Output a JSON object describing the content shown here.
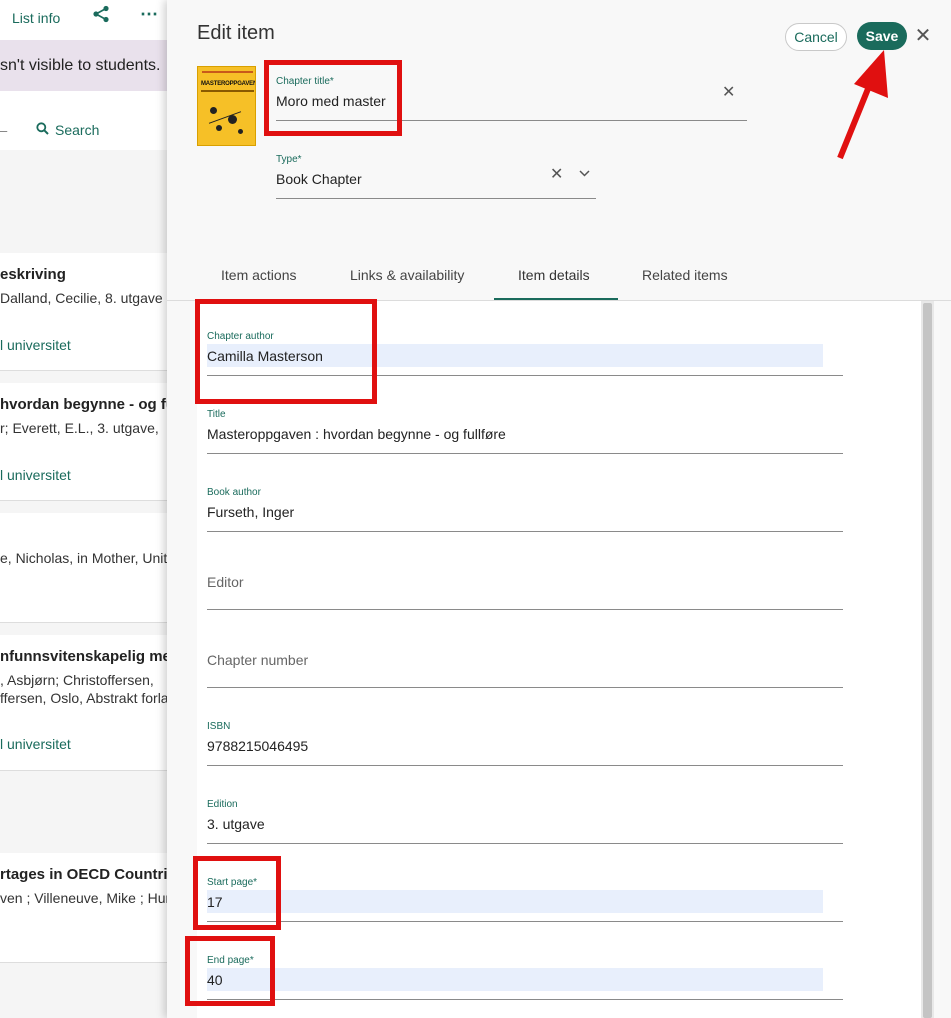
{
  "background": {
    "topbar": {
      "list_info": "List info"
    },
    "banner_text": "sn't visible to students.",
    "search_label": "Search",
    "cards": [
      {
        "title": "eskriving",
        "line1": "Dalland, Cecilie, 8. utgave",
        "link": "l universitet"
      },
      {
        "title": "hvordan begynne - og fu",
        "line1": "r; Everett, E.L., 3. utgave, ",
        "link": "l universitet"
      },
      {
        "title": "",
        "line1": "e, Nicholas, in Mother, Unit",
        "link": ""
      },
      {
        "title": "nfunnsvitenskapelig me",
        "line1": ", Asbjørn; Christoffersen,",
        "line2": "ffersen, Oslo, Abstrakt forla",
        "link": "l universitet"
      },
      {
        "title": "rtages in OECD Countrie",
        "line1": "ven ; Villeneuve, Mike ; Hur",
        "link": ""
      }
    ]
  },
  "panel": {
    "title": "Edit item",
    "buttons": {
      "cancel": "Cancel",
      "save": "Save"
    },
    "cover": {
      "title": "MASTEROPPGAVEN"
    },
    "chapter_title": {
      "label": "Chapter title*",
      "value": "Moro med master"
    },
    "type": {
      "label": "Type*",
      "value": "Book Chapter"
    },
    "tabs": [
      "Item actions",
      "Links & availability",
      "Item details",
      "Related items"
    ],
    "active_tab": "Item details",
    "fields": {
      "chapter_author": {
        "label": "Chapter author",
        "value": "Camilla Masterson"
      },
      "title": {
        "label": "Title",
        "value": "Masteroppgaven : hvordan begynne - og fullføre"
      },
      "book_author": {
        "label": "Book author",
        "value": "Furseth, Inger"
      },
      "editor": {
        "placeholder": "Editor"
      },
      "chapter_number": {
        "placeholder": "Chapter number"
      },
      "isbn": {
        "label": "ISBN",
        "value": "9788215046495"
      },
      "edition": {
        "label": "Edition",
        "value": "3. utgave"
      },
      "start_page": {
        "label": "Start page*",
        "value": "17"
      },
      "end_page": {
        "label": "End page*",
        "value": "40"
      }
    }
  },
  "colors": {
    "accent": "#1a6b5c",
    "annotation": "#e01010",
    "highlight": "#e8effc",
    "banner": "#e9e1ec"
  },
  "icons": {
    "share": "share-icon",
    "more": "more-icon",
    "search": "search-icon",
    "close": "close-icon",
    "clear": "clear-icon",
    "chevron": "chevron-down-icon"
  }
}
